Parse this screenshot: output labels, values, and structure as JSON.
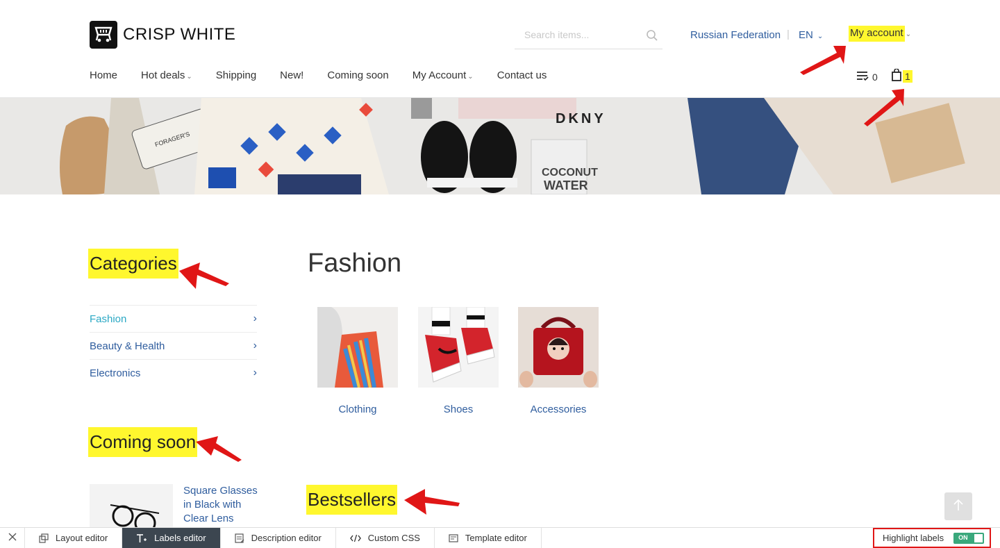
{
  "brand": {
    "name": "CRISP WHITE"
  },
  "search": {
    "placeholder": "Search items..."
  },
  "header": {
    "country": "Russian Federation",
    "separator": "|",
    "language": "EN",
    "account_label": "My account"
  },
  "nav": {
    "items": [
      {
        "label": "Home",
        "dropdown": false
      },
      {
        "label": "Hot deals",
        "dropdown": true
      },
      {
        "label": "Shipping",
        "dropdown": false
      },
      {
        "label": "New!",
        "dropdown": false
      },
      {
        "label": "Coming soon",
        "dropdown": false
      },
      {
        "label": "My Account",
        "dropdown": true
      },
      {
        "label": "Contact us",
        "dropdown": false
      }
    ],
    "wishlist_count": "0",
    "cart_count": "1"
  },
  "banner": {
    "texts": [
      "DKNY",
      "COCONUT",
      "WATER",
      "FORAGER'S"
    ]
  },
  "sidebar": {
    "categories_heading": "Categories",
    "categories": [
      {
        "label": "Fashion",
        "active": true
      },
      {
        "label": "Beauty & Health",
        "active": false
      },
      {
        "label": "Electronics",
        "active": false
      }
    ],
    "coming_soon_heading": "Coming soon",
    "coming_soon_product": "Square Glasses in Black with Clear Lens"
  },
  "main": {
    "title": "Fashion",
    "subcategories": [
      {
        "label": "Clothing"
      },
      {
        "label": "Shoes"
      },
      {
        "label": "Accessories"
      }
    ],
    "bestsellers_heading": "Bestsellers"
  },
  "editor_bar": {
    "tabs": [
      {
        "label": "Layout editor",
        "icon": "layout-icon",
        "active": false
      },
      {
        "label": "Labels editor",
        "icon": "text-icon",
        "active": true
      },
      {
        "label": "Description editor",
        "icon": "description-icon",
        "active": false
      },
      {
        "label": "Custom CSS",
        "icon": "code-icon",
        "active": false
      },
      {
        "label": "Template editor",
        "icon": "template-icon",
        "active": false
      }
    ],
    "highlight_label": "Highlight labels",
    "highlight_state": "ON"
  },
  "colors": {
    "link": "#2f5d9e",
    "active_link": "#2aa8c4",
    "highlight": "#fff72e",
    "arrow": "#e01616",
    "toggle": "#3aa87c"
  }
}
